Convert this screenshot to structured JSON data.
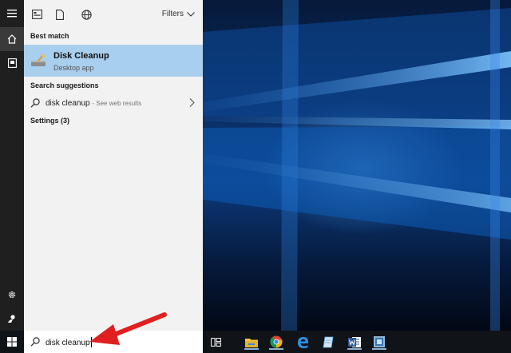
{
  "rail": {
    "items": [
      {
        "name": "menu-icon"
      },
      {
        "name": "home-icon"
      },
      {
        "name": "documents-icon"
      },
      {
        "name": "settings-gear-icon"
      },
      {
        "name": "user-icon"
      }
    ]
  },
  "panel": {
    "top_icons": [
      "apps-icon",
      "documents-icon",
      "web-icon"
    ],
    "filters_label": "Filters",
    "best_match_label": "Best match",
    "best_match": {
      "title": "Disk Cleanup",
      "subtitle": "Desktop app",
      "icon": "disk-cleanup-icon"
    },
    "search_suggestions_label": "Search suggestions",
    "suggestion": {
      "text": "disk cleanup",
      "hint": "- See web results"
    },
    "settings_label": "Settings (3)"
  },
  "taskbar": {
    "search_value": "disk cleanup",
    "apps": [
      "task-view-icon",
      "file-explorer-icon",
      "chrome-icon",
      "edge-icon",
      "notepad-icon",
      "word-icon",
      "app-icon"
    ]
  },
  "colors": {
    "panel_bg": "#f2f2f2",
    "highlight": "#a9cfee",
    "rail_bg": "#1f1f1f",
    "taskbar_bg": "#101418",
    "arrow": "#e02020"
  }
}
